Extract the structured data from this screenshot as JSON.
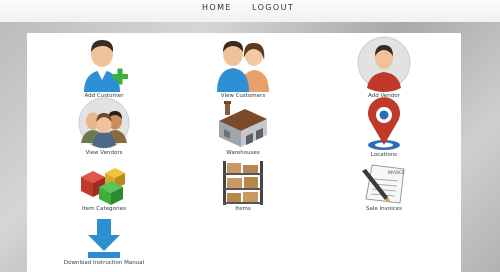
{
  "nav": {
    "home_label": "HOME",
    "logout_label": "LOGOUT"
  },
  "tiles": [
    {
      "label": "Add Customer",
      "icon": "add-customer-icon"
    },
    {
      "label": "View Customers",
      "icon": "view-customers-icon"
    },
    {
      "label": "Add Vendor",
      "icon": "add-vendor-icon"
    },
    {
      "label": "View Vendors",
      "icon": "view-vendors-icon"
    },
    {
      "label": "Warehouses",
      "icon": "warehouse-icon"
    },
    {
      "label": "Locations",
      "icon": "location-pin-icon"
    },
    {
      "label": "Item Categories",
      "icon": "item-categories-icon"
    },
    {
      "label": "Items",
      "icon": "items-shelf-icon"
    },
    {
      "label": "Sale Invoices",
      "icon": "invoice-icon"
    },
    {
      "label": "Download Instruction Manual",
      "icon": "download-icon"
    }
  ],
  "colors": {
    "topbar": "#f5f5f5",
    "panel": "#ffffff",
    "label": "#2b3c4d",
    "accent_red": "#c0392b",
    "accent_blue": "#2b6fb3",
    "accent_green": "#3fae3f"
  }
}
